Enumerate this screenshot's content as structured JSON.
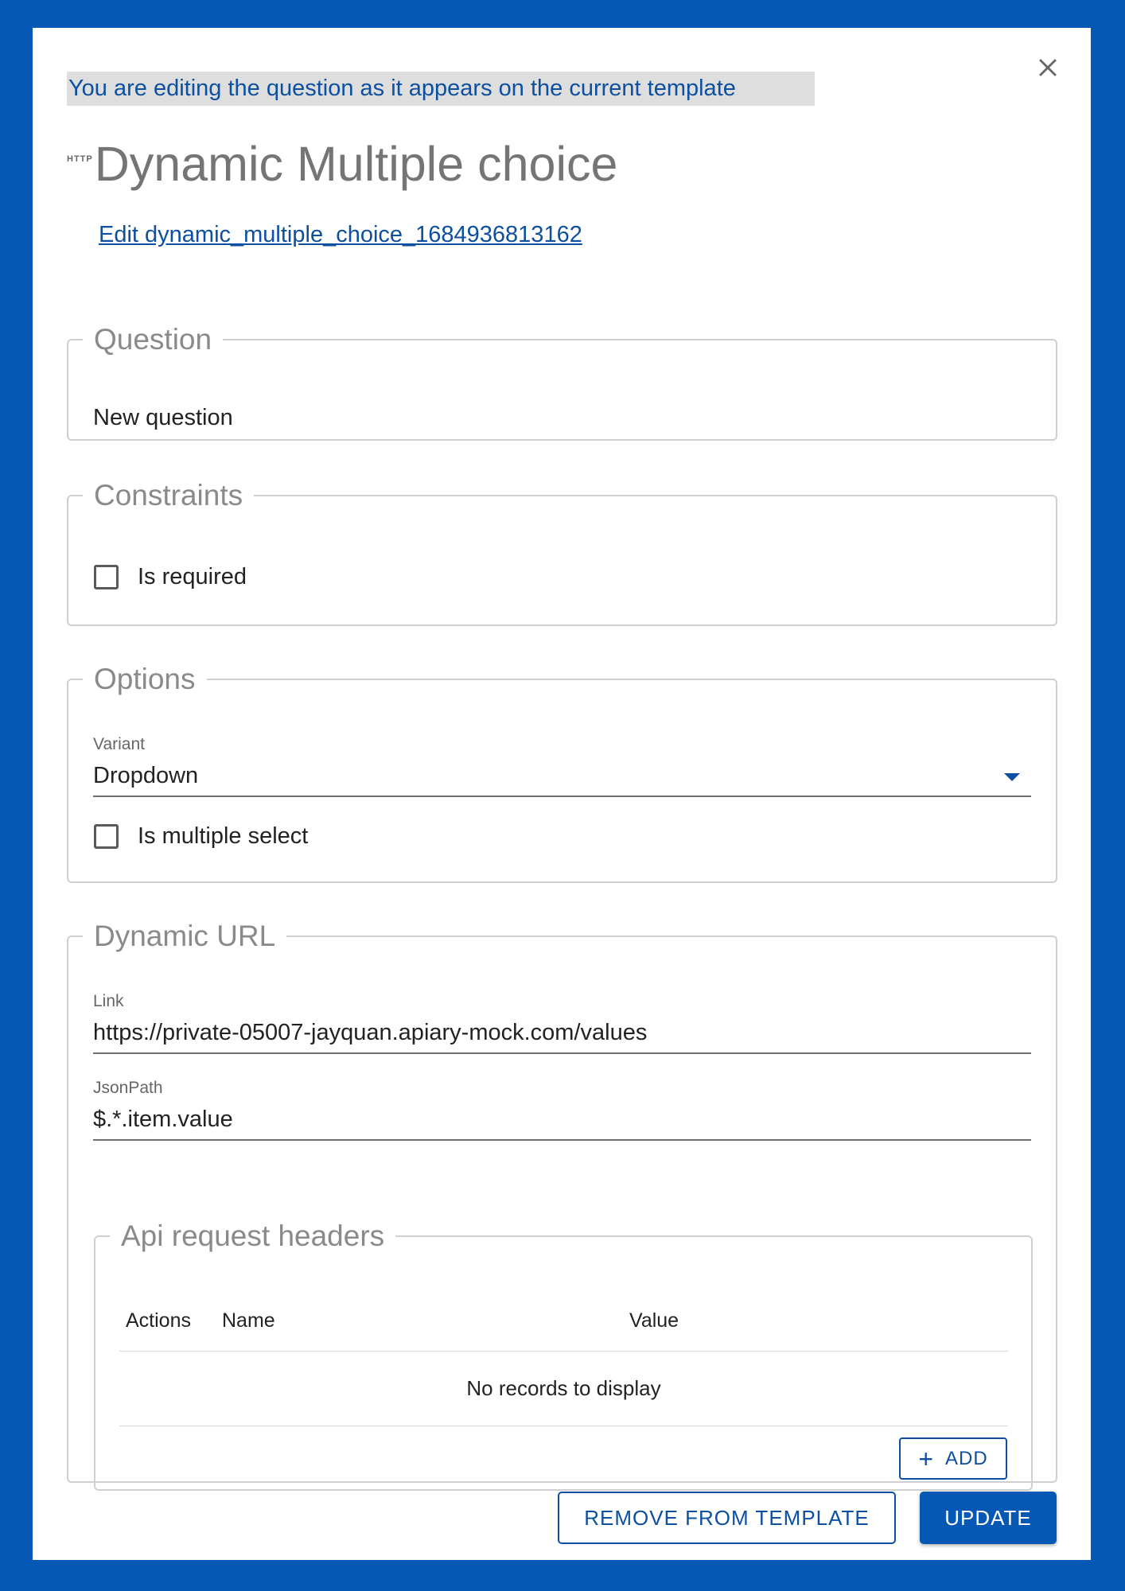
{
  "notice": "You are editing the question as it appears on the current template",
  "badge": "HTTP",
  "title": "Dynamic Multiple choice",
  "edit_link": "Edit dynamic_multiple_choice_1684936813162",
  "question": {
    "legend": "Question",
    "value": "New question"
  },
  "constraints": {
    "legend": "Constraints",
    "required_label": "Is required",
    "required_checked": false
  },
  "options": {
    "legend": "Options",
    "variant_label": "Variant",
    "variant_value": "Dropdown",
    "multiple_label": "Is multiple select",
    "multiple_checked": false
  },
  "dynamic_url": {
    "legend": "Dynamic URL",
    "link_label": "Link",
    "link_value": "https://private-05007-jayquan.apiary-mock.com/values",
    "jsonpath_label": "JsonPath",
    "jsonpath_value": "$.*.item.value"
  },
  "headers": {
    "legend": "Api request headers",
    "columns": [
      "Actions",
      "Name",
      "Value"
    ],
    "empty_text": "No records to display",
    "add_label": "ADD"
  },
  "buttons": {
    "remove": "REMOVE FROM TEMPLATE",
    "update": "UPDATE"
  },
  "colors": {
    "brand": "#0559b5",
    "link": "#0d4fa0"
  },
  "icons": {
    "close": "close-icon",
    "dropdown": "chevron-down-icon",
    "add": "plus-icon"
  }
}
